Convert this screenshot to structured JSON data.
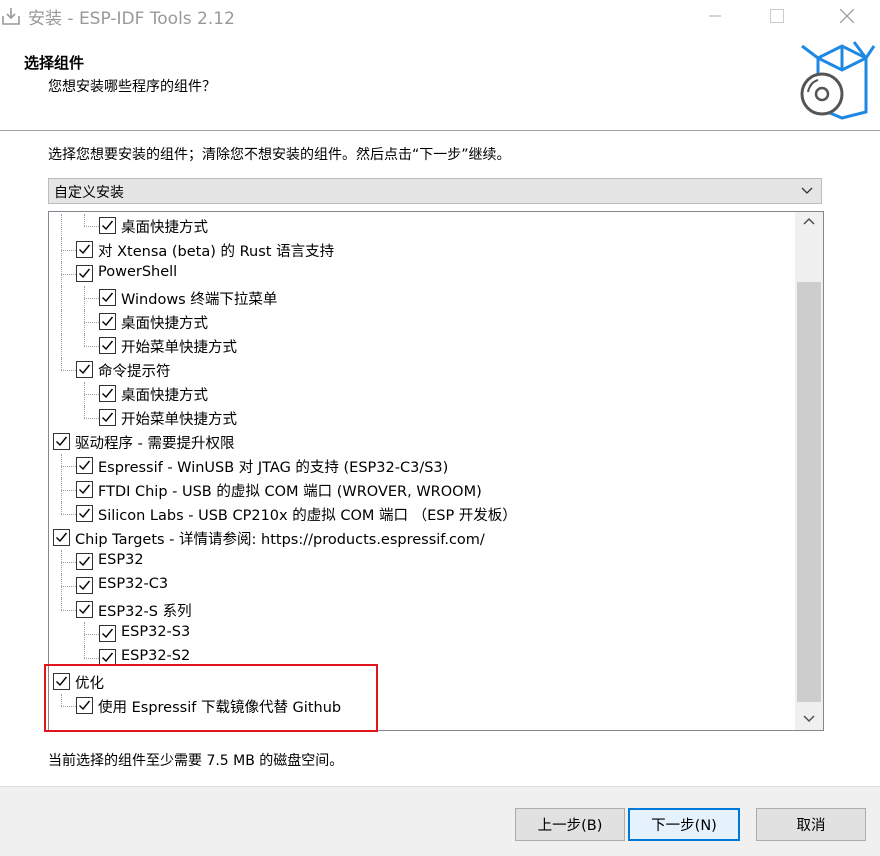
{
  "window": {
    "title": "安装 - ESP-IDF Tools 2.12"
  },
  "header": {
    "title": "选择组件",
    "subtitle": "您想安装哪些程序的组件？",
    "icon": "package-disc-icon"
  },
  "instruction": "选择您想要安装的组件；清除您不想安装的组件。然后点击“下一步”继续。",
  "install_type": {
    "selected": "自定义安装"
  },
  "tree": [
    {
      "label": "桌面快捷方式",
      "checked": true,
      "level": 2
    },
    {
      "label": "对 Xtensa (beta) 的 Rust 语言支持",
      "checked": true,
      "level": 1
    },
    {
      "label": "PowerShell",
      "checked": true,
      "level": 1
    },
    {
      "label": "Windows 终端下拉菜单",
      "checked": true,
      "level": 2
    },
    {
      "label": "桌面快捷方式",
      "checked": true,
      "level": 2
    },
    {
      "label": "开始菜单快捷方式",
      "checked": true,
      "level": 2
    },
    {
      "label": "命令提示符",
      "checked": true,
      "level": 1
    },
    {
      "label": "桌面快捷方式",
      "checked": true,
      "level": 2
    },
    {
      "label": "开始菜单快捷方式",
      "checked": true,
      "level": 2
    },
    {
      "label": "驱动程序 - 需要提升权限",
      "checked": true,
      "level": 0
    },
    {
      "label": "Espressif - WinUSB 对 JTAG 的支持 (ESP32-C3/S3)",
      "checked": true,
      "level": 1
    },
    {
      "label": "FTDI Chip - USB 的虚拟 COM 端口 (WROVER, WROOM)",
      "checked": true,
      "level": 1
    },
    {
      "label": "Silicon Labs - USB CP210x 的虚拟 COM 端口 （ESP 开发板）",
      "checked": true,
      "level": 1
    },
    {
      "label": "Chip Targets - 详情请参阅: https://products.espressif.com/",
      "checked": true,
      "level": 0
    },
    {
      "label": "ESP32",
      "checked": true,
      "level": 1
    },
    {
      "label": "ESP32-C3",
      "checked": true,
      "level": 1
    },
    {
      "label": "ESP32-S 系列",
      "checked": true,
      "level": 1
    },
    {
      "label": "ESP32-S3",
      "checked": true,
      "level": 2
    },
    {
      "label": "ESP32-S2",
      "checked": true,
      "level": 2
    },
    {
      "label": "优化",
      "checked": true,
      "level": 0
    },
    {
      "label": "使用 Espressif 下载镜像代替 Github",
      "checked": true,
      "level": 1
    }
  ],
  "disk_space": "当前选择的组件至少需要 7.5 MB 的磁盘空间。",
  "buttons": {
    "back": "上一步(B)",
    "next": "下一步(N)",
    "cancel": "取消"
  },
  "colors": {
    "highlight_border": "#e0161c",
    "focus_border": "#0078d7",
    "footer_bg": "#f0f0f0"
  }
}
